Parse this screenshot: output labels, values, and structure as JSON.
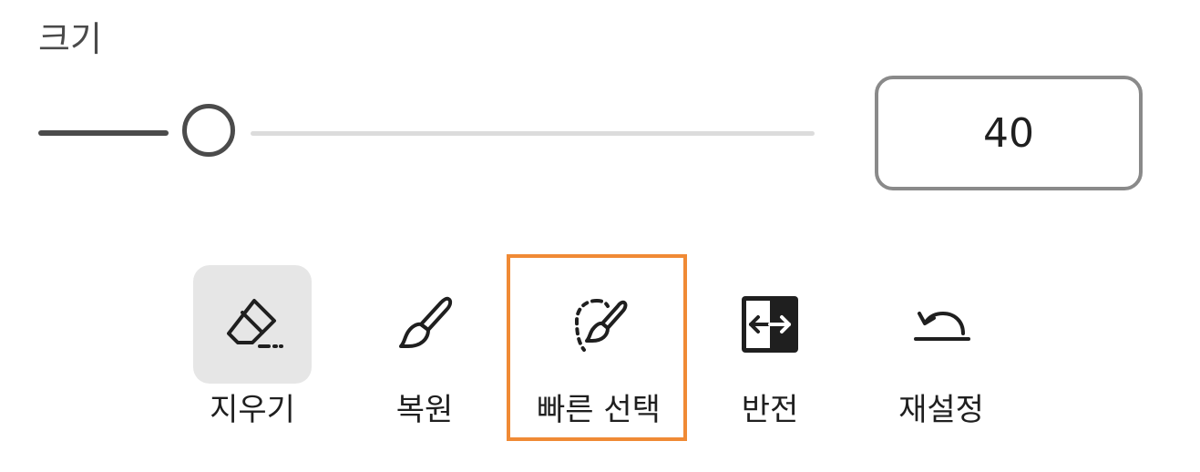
{
  "size": {
    "label": "크기",
    "value": "40",
    "slider_fraction": 0.22
  },
  "tools": [
    {
      "id": "erase",
      "label": "지우기",
      "icon": "eraser-icon",
      "active": true
    },
    {
      "id": "restore",
      "label": "복원",
      "icon": "brush-icon",
      "active": false
    },
    {
      "id": "quick-select",
      "label": "빠른 선택",
      "icon": "quick-select-brush-icon",
      "active": false,
      "highlighted": true
    },
    {
      "id": "invert",
      "label": "반전",
      "icon": "invert-icon",
      "active": false
    },
    {
      "id": "reset",
      "label": "재설정",
      "icon": "reset-icon",
      "active": false
    }
  ],
  "colors": {
    "highlight": "#f08a35",
    "active_bg": "#e6e6e6",
    "slider_fill": "#4b4b4b",
    "slider_track": "#dcdcdc"
  }
}
